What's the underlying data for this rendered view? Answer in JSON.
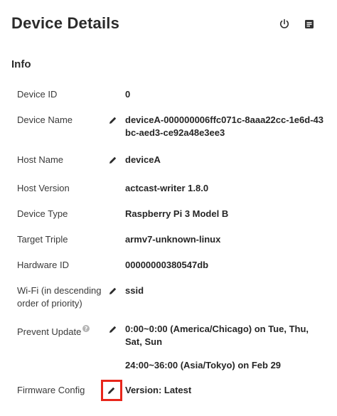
{
  "header": {
    "title": "Device Details",
    "power_icon": "power-icon",
    "notes_icon": "notes-icon"
  },
  "section": {
    "title": "Info"
  },
  "rows": {
    "device_id": {
      "label": "Device ID",
      "value": "0"
    },
    "device_name": {
      "label": "Device Name",
      "value": "deviceA-000000006ffc071c-8aaa22cc-1e6d-43bc-aed3-ce92a48e3ee3"
    },
    "host_name": {
      "label": "Host Name",
      "value": "deviceA"
    },
    "host_version": {
      "label": "Host Version",
      "value": "actcast-writer 1.8.0"
    },
    "device_type": {
      "label": "Device Type",
      "value": "Raspberry Pi 3 Model B"
    },
    "target_triple": {
      "label": "Target Triple",
      "value": "armv7-unknown-linux"
    },
    "hardware_id": {
      "label": "Hardware ID",
      "value": "00000000380547db"
    },
    "wifi": {
      "label": "Wi-Fi (in descending order of priority)",
      "value": "ssid"
    },
    "prevent_update": {
      "label": "Prevent Update",
      "help_icon": "help-icon",
      "values": [
        "0:00~0:00 (America/Chicago) on Tue, Thu, Sat, Sun",
        "24:00~36:00 (Asia/Tokyo) on Feb 29"
      ]
    },
    "firmware_config": {
      "label": "Firmware Config",
      "value": "Version: Latest"
    }
  },
  "colors": {
    "highlight": "#e8261b",
    "text": "#262626",
    "label": "#3a3a3a"
  }
}
